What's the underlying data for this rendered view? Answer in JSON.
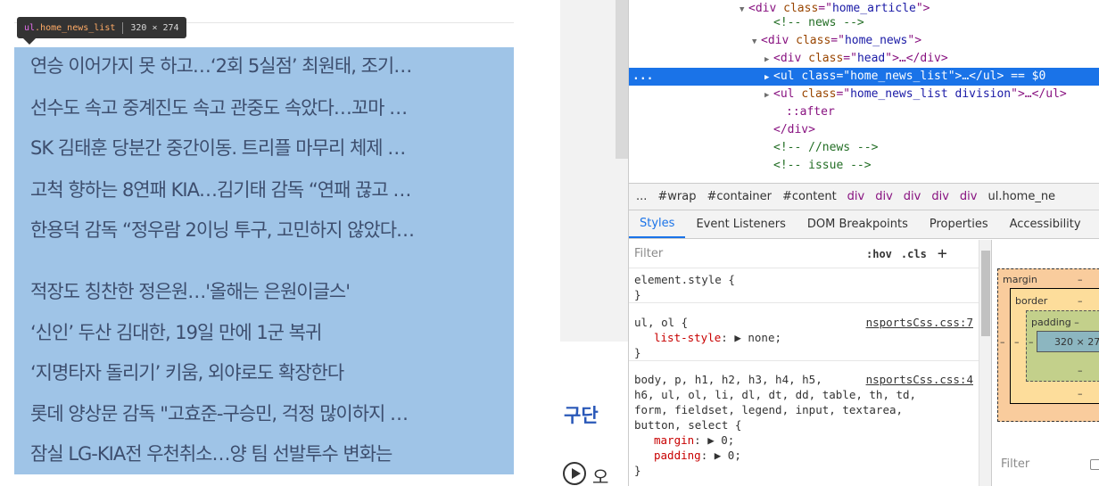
{
  "tooltip": {
    "tag": "ul",
    "class_name": ".home_news_list",
    "dims": "320 × 274"
  },
  "news": {
    "items": [
      "연승 이어가지 못 하고…‘2회 5실점’ 최원태, 조기…",
      "선수도 속고 중계진도 속고 관중도 속았다…꼬마 …",
      "SK 김태훈 당분간 중간이동. 트리플 마무리 체제 …",
      "고척 향하는 8연패 KIA…김기태 감독 “연패 끊고 …",
      "한용덕 감독 “정우람 2이닝 투구, 고민하지 않았다…",
      "적장도 칭찬한 정은원…'올해는 은원이글스'",
      "‘신인’ 두산 김대한, 19일 만에 1군 복귀",
      "‘지명타자 돌리기’ 키움, 외야로도 확장한다",
      "롯데 양상문 감독 \"고효준-구승민, 걱정 많이하지 …",
      "잠실 LG-KIA전 우천취소…양 팀 선발투수 변화는"
    ]
  },
  "page_partial": {
    "cut_title": "구단",
    "play_text": "오"
  },
  "dom": {
    "lines": [
      {
        "indent": 124,
        "tri": "▼",
        "parts": [
          [
            "tag",
            "<div "
          ],
          [
            "attr",
            "class"
          ],
          [
            "tag",
            "=\""
          ],
          [
            "val",
            "home_article"
          ],
          [
            "tag",
            "\">"
          ]
        ]
      },
      {
        "indent": 152,
        "tri": "",
        "parts": [
          [
            "comment",
            "<!-- news -->"
          ]
        ]
      },
      {
        "indent": 138,
        "tri": "▼",
        "parts": [
          [
            "tag",
            "<div "
          ],
          [
            "attr",
            "class"
          ],
          [
            "tag",
            "=\""
          ],
          [
            "val",
            "home_news"
          ],
          [
            "tag",
            "\">"
          ]
        ]
      },
      {
        "indent": 152,
        "tri": "▶",
        "parts": [
          [
            "tag",
            "<div "
          ],
          [
            "attr",
            "class"
          ],
          [
            "tag",
            "=\""
          ],
          [
            "val",
            "head"
          ],
          [
            "tag",
            "\">…</div>"
          ]
        ]
      },
      {
        "indent": 152,
        "tri": "▶",
        "parts": [
          [
            "tag",
            "<ul "
          ],
          [
            "attr",
            "class"
          ],
          [
            "tag",
            "=\""
          ],
          [
            "val",
            "home_news_list"
          ],
          [
            "tag",
            "\">…</ul>"
          ],
          [
            "eq",
            " == $0"
          ]
        ],
        "selected": true
      },
      {
        "indent": 152,
        "tri": "▶",
        "parts": [
          [
            "tag",
            "<ul "
          ],
          [
            "attr",
            "class"
          ],
          [
            "tag",
            "=\""
          ],
          [
            "val",
            "home_news_list division"
          ],
          [
            "tag",
            "\">…</ul>"
          ]
        ]
      },
      {
        "indent": 166,
        "tri": "",
        "parts": [
          [
            "pseudo",
            "::after"
          ]
        ]
      },
      {
        "indent": 152,
        "tri": "",
        "parts": [
          [
            "tag",
            "</div>"
          ]
        ]
      },
      {
        "indent": 152,
        "tri": "",
        "parts": [
          [
            "comment",
            "<!-- //news -->"
          ]
        ]
      },
      {
        "indent": 152,
        "tri": "",
        "parts": [
          [
            "comment",
            "<!-- issue -->"
          ]
        ]
      }
    ],
    "selected_dots": "..."
  },
  "breadcrumb": {
    "items": [
      "...",
      "#wrap",
      "#container",
      "#content",
      "div",
      "div",
      "div",
      "div",
      "div",
      "ul.home_ne"
    ]
  },
  "tabs": {
    "items": [
      "Styles",
      "Event Listeners",
      "DOM Breakpoints",
      "Properties",
      "Accessibility"
    ],
    "active": "Styles"
  },
  "styles": {
    "filter_placeholder": "Filter",
    "hov": ":hov",
    "cls": ".cls",
    "plus": "+",
    "element_style_open": "element.style {",
    "element_style_close": "}",
    "rule1_selector": "ul, ol {",
    "rule1_source": "nsportsCss.css:7",
    "rule1_prop": "list-style",
    "rule1_value": "none;",
    "rule1_close": "}",
    "rule2_selector_1": "body, p, h1, h2, h3, h4, h5,",
    "rule2_source": "nsportsCss.css:4",
    "rule2_selector_2": "h6, ul, ol, li, dl, dt, dd, table, th, td,",
    "rule2_selector_3": "form, fieldset, legend, input, textarea,",
    "rule2_selector_4": "button, select {",
    "rule2_prop_1": "margin",
    "rule2_val_1": "0;",
    "rule2_prop_2": "padding",
    "rule2_val_2": "0;",
    "rule2_close": "}"
  },
  "box_model": {
    "margin_label": "margin",
    "margin_val": "–",
    "border_label": "border",
    "border_val": "–",
    "padding_label": "padding –",
    "content": "320 × 274",
    "side_dash": "–",
    "filter_label": "Filter"
  },
  "colors": {
    "highlight": "#9fc4e7",
    "selected_row": "#1a73e8"
  }
}
